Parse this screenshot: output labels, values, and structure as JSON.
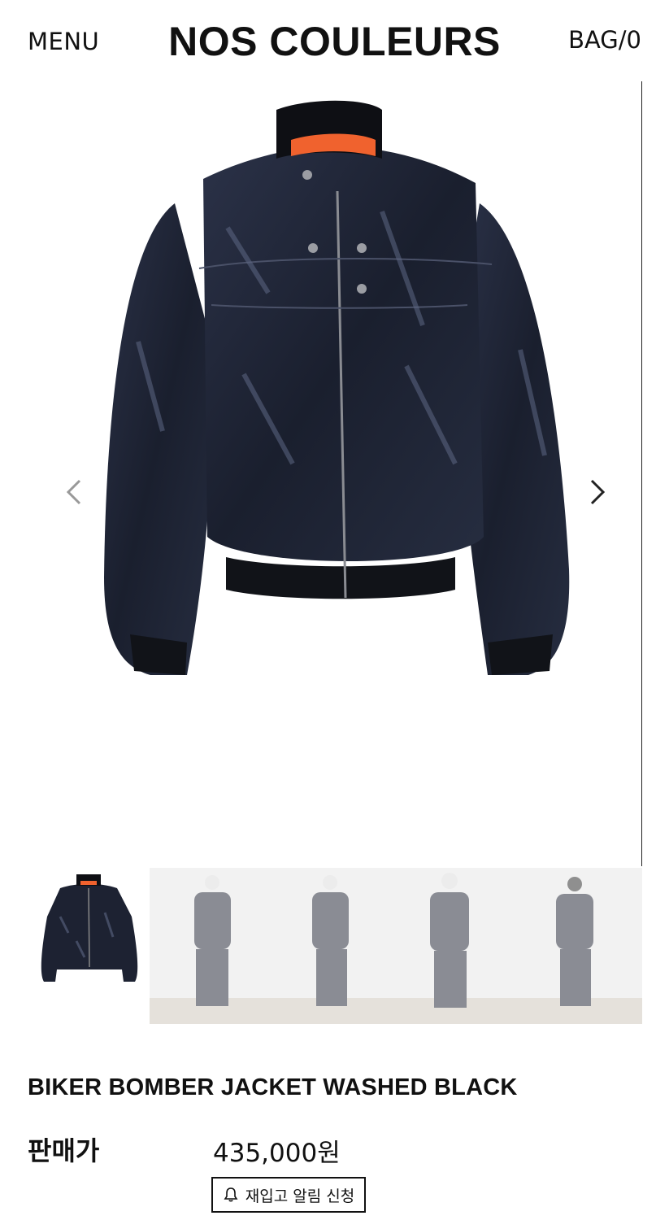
{
  "header": {
    "menu_label": "MENU",
    "brand_name": "NOS COULEURS",
    "bag_label": "BAG/0"
  },
  "gallery": {
    "main_image_icon": "jacket-product-image",
    "prev_icon": "chevron-left-icon",
    "next_icon": "chevron-right-icon",
    "thumbnails": [
      {
        "icon": "jacket-thumbnail"
      },
      {
        "icon": "lookbook-thumbnail"
      }
    ]
  },
  "product": {
    "title": "BIKER BOMBER JACKET WASHED BLACK",
    "price_label": "판매가",
    "price_value": "435,000원",
    "restock_button_label": "재입고 알림 신청",
    "restock_icon": "bell-icon"
  },
  "colors": {
    "accent_orange": "#f0622e",
    "jacket_dark": "#1b2030",
    "text": "#111111"
  }
}
